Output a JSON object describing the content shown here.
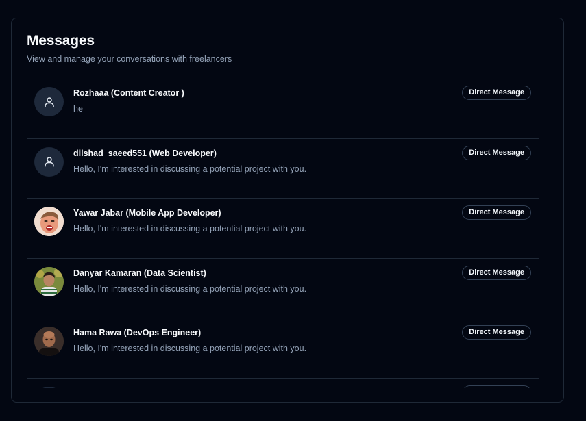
{
  "messages": {
    "title": "Messages",
    "subtitle": "View and manage your conversations with freelancers",
    "conversations": [
      {
        "name": "Rozhaaa (Content Creator )",
        "preview": "he",
        "badge": "Direct Message",
        "avatar": "user-icon"
      },
      {
        "name": "dilshad_saeed551 (Web Developer)",
        "preview": "Hello, I'm interested in discussing a potential project with you.",
        "badge": "Direct Message",
        "avatar": "user-icon"
      },
      {
        "name": "Yawar Jabar (Mobile App Developer)",
        "preview": "Hello, I'm interested in discussing a potential project with you.",
        "badge": "Direct Message",
        "avatar": "photo"
      },
      {
        "name": "Danyar Kamaran (Data Scientist)",
        "preview": "Hello, I'm interested in discussing a potential project with you.",
        "badge": "Direct Message",
        "avatar": "photo"
      },
      {
        "name": "Hama Rawa (DevOps Engineer)",
        "preview": "Hello, I'm interested in discussing a potential project with you.",
        "badge": "Direct Message",
        "avatar": "photo"
      }
    ]
  },
  "colors": {
    "background": "#030712",
    "border": "#1f2937",
    "muted_text": "#94a3b8",
    "avatar_bg": "#1e293b"
  }
}
